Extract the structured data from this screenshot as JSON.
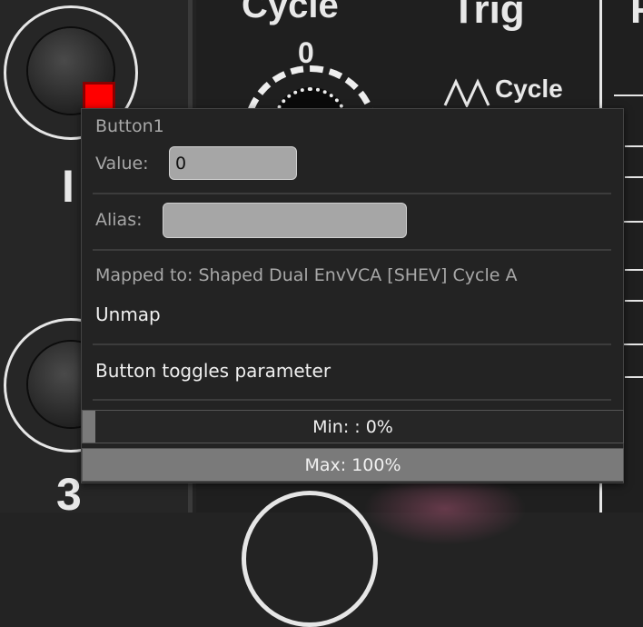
{
  "module": {
    "section_labels": [
      "Cycle",
      "Trig"
    ],
    "dial_value": "0",
    "cycle_glyph_label": "Cycle",
    "left_labels": [
      "I",
      "3"
    ],
    "led_color": "#ff0000"
  },
  "popup": {
    "title": "Button1",
    "value_label": "Value:",
    "value": "0",
    "alias_label": "Alias:",
    "alias_value": "",
    "mapped_to": "Mapped to: Shaped Dual EnvVCA [SHEV] Cycle A",
    "unmap_label": "Unmap",
    "toggle_label": "Button toggles parameter",
    "min_slider": {
      "text": "Min: : 0%",
      "level": 0.0
    },
    "max_slider": {
      "text": "Max: 100%",
      "level": 1.0
    }
  }
}
